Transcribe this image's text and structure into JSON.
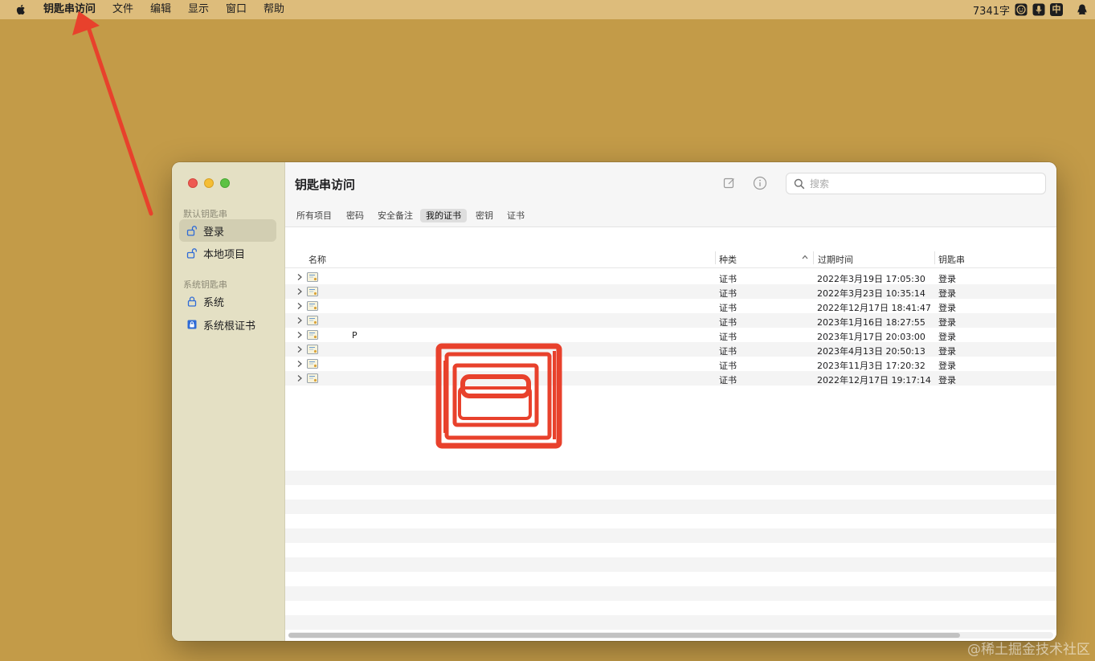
{
  "menubar": {
    "app_name": "钥匙串访问",
    "items": [
      "文件",
      "编辑",
      "显示",
      "窗口",
      "帮助"
    ],
    "status_text": "7341字",
    "ime_label": "中"
  },
  "window": {
    "title": "钥匙串访问",
    "search_placeholder": "搜索",
    "sidebar": {
      "default_section": "默认钥匙串",
      "default_items": [
        "登录",
        "本地项目"
      ],
      "system_section": "系统钥匙串",
      "system_items": [
        "系统",
        "系统根证书"
      ]
    },
    "tabs": [
      "所有项目",
      "密码",
      "安全备注",
      "我的证书",
      "密钥",
      "证书"
    ],
    "active_tab": "我的证书",
    "columns": [
      "名称",
      "种类",
      "过期时间",
      "钥匙串"
    ],
    "rows": [
      {
        "name": "",
        "kind": "证书",
        "expires": "2022年3月19日 17:05:30",
        "keychain": "登录"
      },
      {
        "name": "",
        "kind": "证书",
        "expires": "2022年3月23日 10:35:14",
        "keychain": "登录"
      },
      {
        "name": "",
        "kind": "证书",
        "expires": "2022年12月17日 18:41:47",
        "keychain": "登录"
      },
      {
        "name": "",
        "kind": "证书",
        "expires": "2023年1月16日 18:27:55",
        "keychain": "登录"
      },
      {
        "name": "P",
        "kind": "证书",
        "expires": "2023年1月17日 20:03:00",
        "keychain": "登录"
      },
      {
        "name": "",
        "kind": "证书",
        "expires": "2023年4月13日 20:50:13",
        "keychain": "登录"
      },
      {
        "name": "",
        "kind": "证书",
        "expires": "2023年11月3日 17:20:32",
        "keychain": "登录"
      },
      {
        "name": "",
        "kind": "证书",
        "expires": "2022年12月17日 19:17:14",
        "keychain": "登录"
      }
    ]
  },
  "watermark": "@稀土掘金技术社区",
  "colors": {
    "desktop": "#c39b48",
    "menubar": "#ddbc7b",
    "sidebar": "#e4e0c4",
    "annotation_red": "#e8412c"
  }
}
